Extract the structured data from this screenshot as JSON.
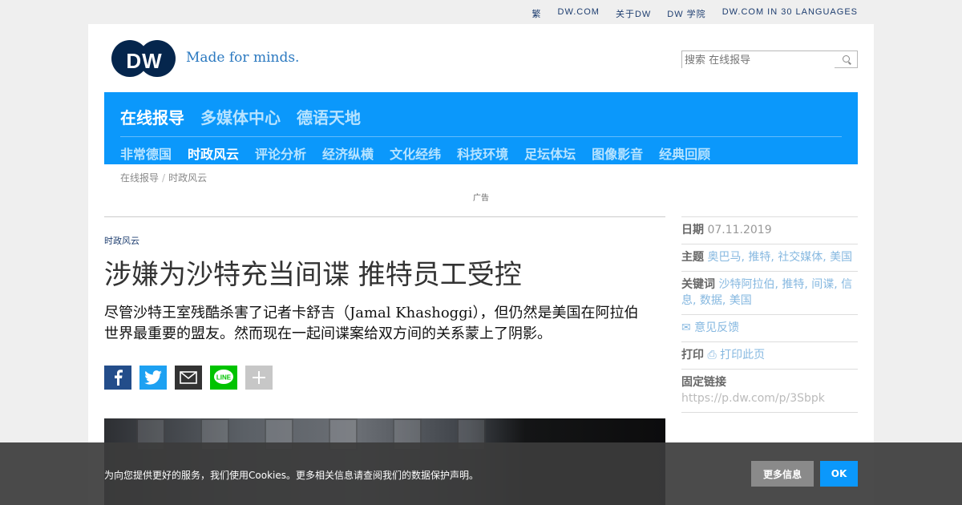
{
  "top_links": [
    "繁",
    "DW.COM",
    "关于DW",
    "DW 学院",
    "DW.COM IN 30 LANGUAGES"
  ],
  "header": {
    "logo_text": "DW",
    "tagline": "Made for minds.",
    "search_placeholder": "搜索 在线报导"
  },
  "nav": {
    "main": [
      "在线报导",
      "多媒体中心",
      "德语天地"
    ],
    "sub": [
      "非常德国",
      "时政风云",
      "评论分析",
      "经济纵横",
      "文化经纬",
      "科技环境",
      "足坛体坛",
      "图像影音",
      "经典回顾"
    ]
  },
  "breadcrumb": [
    "在线报导",
    "时政风云"
  ],
  "ad_label": "广告",
  "article": {
    "kicker": "时政风云",
    "headline": "涉嫌为沙特充当间谍 推特员工受控",
    "teaser": "尽管沙特王室残酷杀害了记者卡舒吉（Jamal Khashoggi），但仍然是美国在阿拉伯世界最重要的盟友。然而现在一起间谍案给双方间的关系蒙上了阴影。"
  },
  "sidebar": {
    "date_label": "日期",
    "date_value": "07.11.2019",
    "topics_label": "主题",
    "topics_value": "奥巴马, 推特, 社交媒体, 美国",
    "keywords_label": "关键词",
    "keywords_value": "沙特阿拉伯, 推特, 间谍, 信息, 数据, 美国",
    "feedback": "✉ 意见反馈",
    "print_label": "打印",
    "print_link": "⎙ 打印此页",
    "permalink_label": "固定链接",
    "permalink_value": "https://p.dw.com/p/3Sbpk"
  },
  "cookie": {
    "text": "为向您提供更好的服务，我们使用Cookies。更多相关信息请查阅我们的数据保护声明。",
    "more_info": "更多信息",
    "ok": "OK"
  },
  "colors": {
    "nav_bg": "#0b98fb",
    "logo": "#05264d",
    "accent_link": "#1e3e70"
  }
}
